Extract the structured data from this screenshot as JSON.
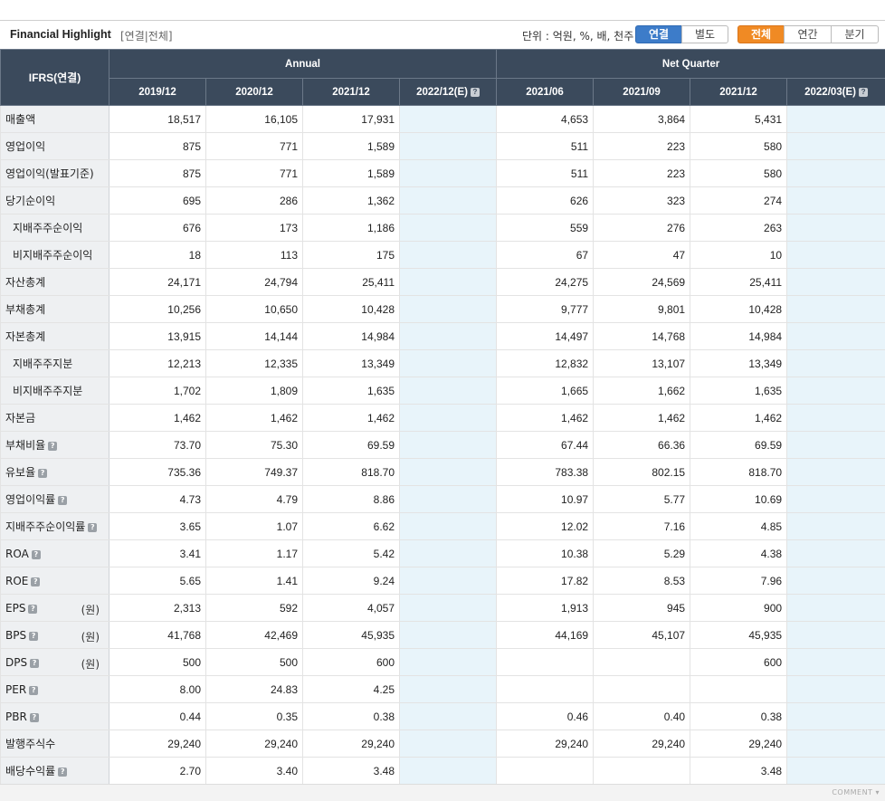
{
  "header": {
    "title": "Financial Highlight",
    "sub": "[연결|전체]",
    "unit": "단위 : 억원, %, 배, 천주",
    "consolidation_tabs": [
      "연결",
      "별도"
    ],
    "period_tabs": [
      "전체",
      "연간",
      "분기"
    ]
  },
  "table": {
    "corner": "IFRS(연결)",
    "group_annual": "Annual",
    "group_quarter": "Net Quarter",
    "columns": [
      "2019/12",
      "2020/12",
      "2021/12",
      "2022/12(E)",
      "2021/06",
      "2021/09",
      "2021/12",
      "2022/03(E)"
    ],
    "rows": [
      {
        "label": "매출액",
        "values": [
          "18,517",
          "16,105",
          "17,931",
          "",
          "4,653",
          "3,864",
          "5,431",
          ""
        ]
      },
      {
        "label": "영업이익",
        "values": [
          "875",
          "771",
          "1,589",
          "",
          "511",
          "223",
          "580",
          ""
        ]
      },
      {
        "label": "영업이익(발표기준)",
        "values": [
          "875",
          "771",
          "1,589",
          "",
          "511",
          "223",
          "580",
          ""
        ]
      },
      {
        "label": "당기순이익",
        "values": [
          "695",
          "286",
          "1,362",
          "",
          "626",
          "323",
          "274",
          ""
        ]
      },
      {
        "label": "지배주주순이익",
        "values": [
          "676",
          "173",
          "1,186",
          "",
          "559",
          "276",
          "263",
          ""
        ]
      },
      {
        "label": "비지배주주순이익",
        "values": [
          "18",
          "113",
          "175",
          "",
          "67",
          "47",
          "10",
          ""
        ]
      },
      {
        "label": "자산총계",
        "values": [
          "24,171",
          "24,794",
          "25,411",
          "",
          "24,275",
          "24,569",
          "25,411",
          ""
        ]
      },
      {
        "label": "부채총계",
        "values": [
          "10,256",
          "10,650",
          "10,428",
          "",
          "9,777",
          "9,801",
          "10,428",
          ""
        ]
      },
      {
        "label": "자본총계",
        "values": [
          "13,915",
          "14,144",
          "14,984",
          "",
          "14,497",
          "14,768",
          "14,984",
          ""
        ]
      },
      {
        "label": "지배주주지분",
        "values": [
          "12,213",
          "12,335",
          "13,349",
          "",
          "12,832",
          "13,107",
          "13,349",
          ""
        ]
      },
      {
        "label": "비지배주주지분",
        "values": [
          "1,702",
          "1,809",
          "1,635",
          "",
          "1,665",
          "1,662",
          "1,635",
          ""
        ]
      },
      {
        "label": "자본금",
        "values": [
          "1,462",
          "1,462",
          "1,462",
          "",
          "1,462",
          "1,462",
          "1,462",
          ""
        ]
      },
      {
        "label": "부채비율",
        "values": [
          "73.70",
          "75.30",
          "69.59",
          "",
          "67.44",
          "66.36",
          "69.59",
          ""
        ]
      },
      {
        "label": "유보율",
        "values": [
          "735.36",
          "749.37",
          "818.70",
          "",
          "783.38",
          "802.15",
          "818.70",
          ""
        ]
      },
      {
        "label": "영업이익률",
        "values": [
          "4.73",
          "4.79",
          "8.86",
          "",
          "10.97",
          "5.77",
          "10.69",
          ""
        ]
      },
      {
        "label": "지배주주순이익률",
        "values": [
          "3.65",
          "1.07",
          "6.62",
          "",
          "12.02",
          "7.16",
          "4.85",
          ""
        ]
      },
      {
        "label": "ROA",
        "values": [
          "3.41",
          "1.17",
          "5.42",
          "",
          "10.38",
          "5.29",
          "4.38",
          ""
        ]
      },
      {
        "label": "ROE",
        "values": [
          "5.65",
          "1.41",
          "9.24",
          "",
          "17.82",
          "8.53",
          "7.96",
          ""
        ]
      },
      {
        "label": "EPS",
        "unit": "(원)",
        "values": [
          "2,313",
          "592",
          "4,057",
          "",
          "1,913",
          "945",
          "900",
          ""
        ]
      },
      {
        "label": "BPS",
        "unit": "(원)",
        "values": [
          "41,768",
          "42,469",
          "45,935",
          "",
          "44,169",
          "45,107",
          "45,935",
          ""
        ]
      },
      {
        "label": "DPS",
        "unit": "(원)",
        "values": [
          "500",
          "500",
          "600",
          "",
          "",
          "",
          "600",
          ""
        ]
      },
      {
        "label": "PER",
        "values": [
          "8.00",
          "24.83",
          "4.25",
          "",
          "",
          "",
          "",
          ""
        ]
      },
      {
        "label": "PBR",
        "values": [
          "0.44",
          "0.35",
          "0.38",
          "",
          "0.46",
          "0.40",
          "0.38",
          ""
        ]
      },
      {
        "label": "발행주식수",
        "values": [
          "29,240",
          "29,240",
          "29,240",
          "",
          "29,240",
          "29,240",
          "29,240",
          ""
        ]
      },
      {
        "label": "배당수익률",
        "values": [
          "2.70",
          "3.40",
          "3.48",
          "",
          "",
          "",
          "3.48",
          ""
        ]
      }
    ]
  },
  "help_glyph": "?",
  "footer": {
    "comment": "COMMENT ▾"
  },
  "colors": {
    "header_bg": "#3b4a5c",
    "estimate_bg": "#e8f4fa",
    "label_bg": "#eef0f2",
    "blue_tab": "#3d7cc9",
    "orange_tab": "#f08a24"
  }
}
